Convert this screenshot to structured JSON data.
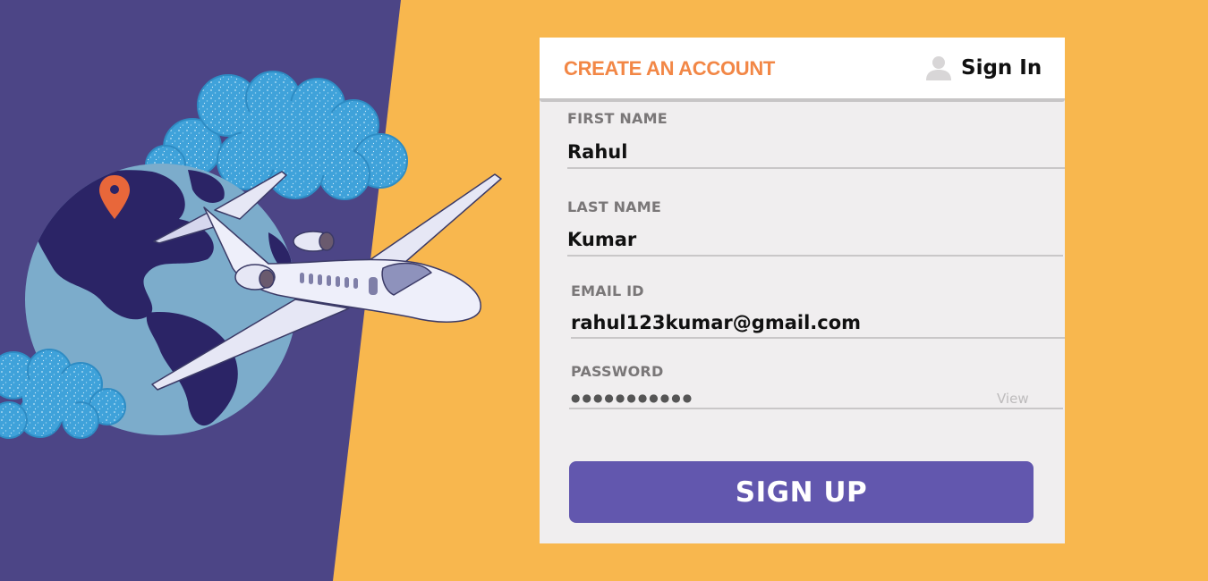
{
  "colors": {
    "background_left": "#4C4586",
    "background_right": "#F8B74E",
    "globe_ocean": "#7CACCB",
    "globe_land": "#2B2466",
    "cloud": "#3FA2DA",
    "pin": "#E8673A",
    "accent_title": "#F28746",
    "button": "#6257AE",
    "card": "#F0EEEF"
  },
  "illustration": {
    "icons": [
      "globe-icon",
      "cloud-icon",
      "location-pin-icon",
      "airplane-icon"
    ]
  },
  "header": {
    "title": "CREATE AN ACCOUNT",
    "signin_label": "Sign In",
    "signin_icon": "user-icon"
  },
  "form": {
    "first_name": {
      "label": "FIRST NAME",
      "value": "Rahul"
    },
    "last_name": {
      "label": "LAST NAME",
      "value": "Kumar"
    },
    "email": {
      "label": "EMAIL ID",
      "value": "rahul123kumar@gmail.com"
    },
    "password": {
      "label": "PASSWORD",
      "masked": "●●●●●●●●●●●",
      "view_label": "View"
    },
    "submit_label": "SIGN UP"
  }
}
